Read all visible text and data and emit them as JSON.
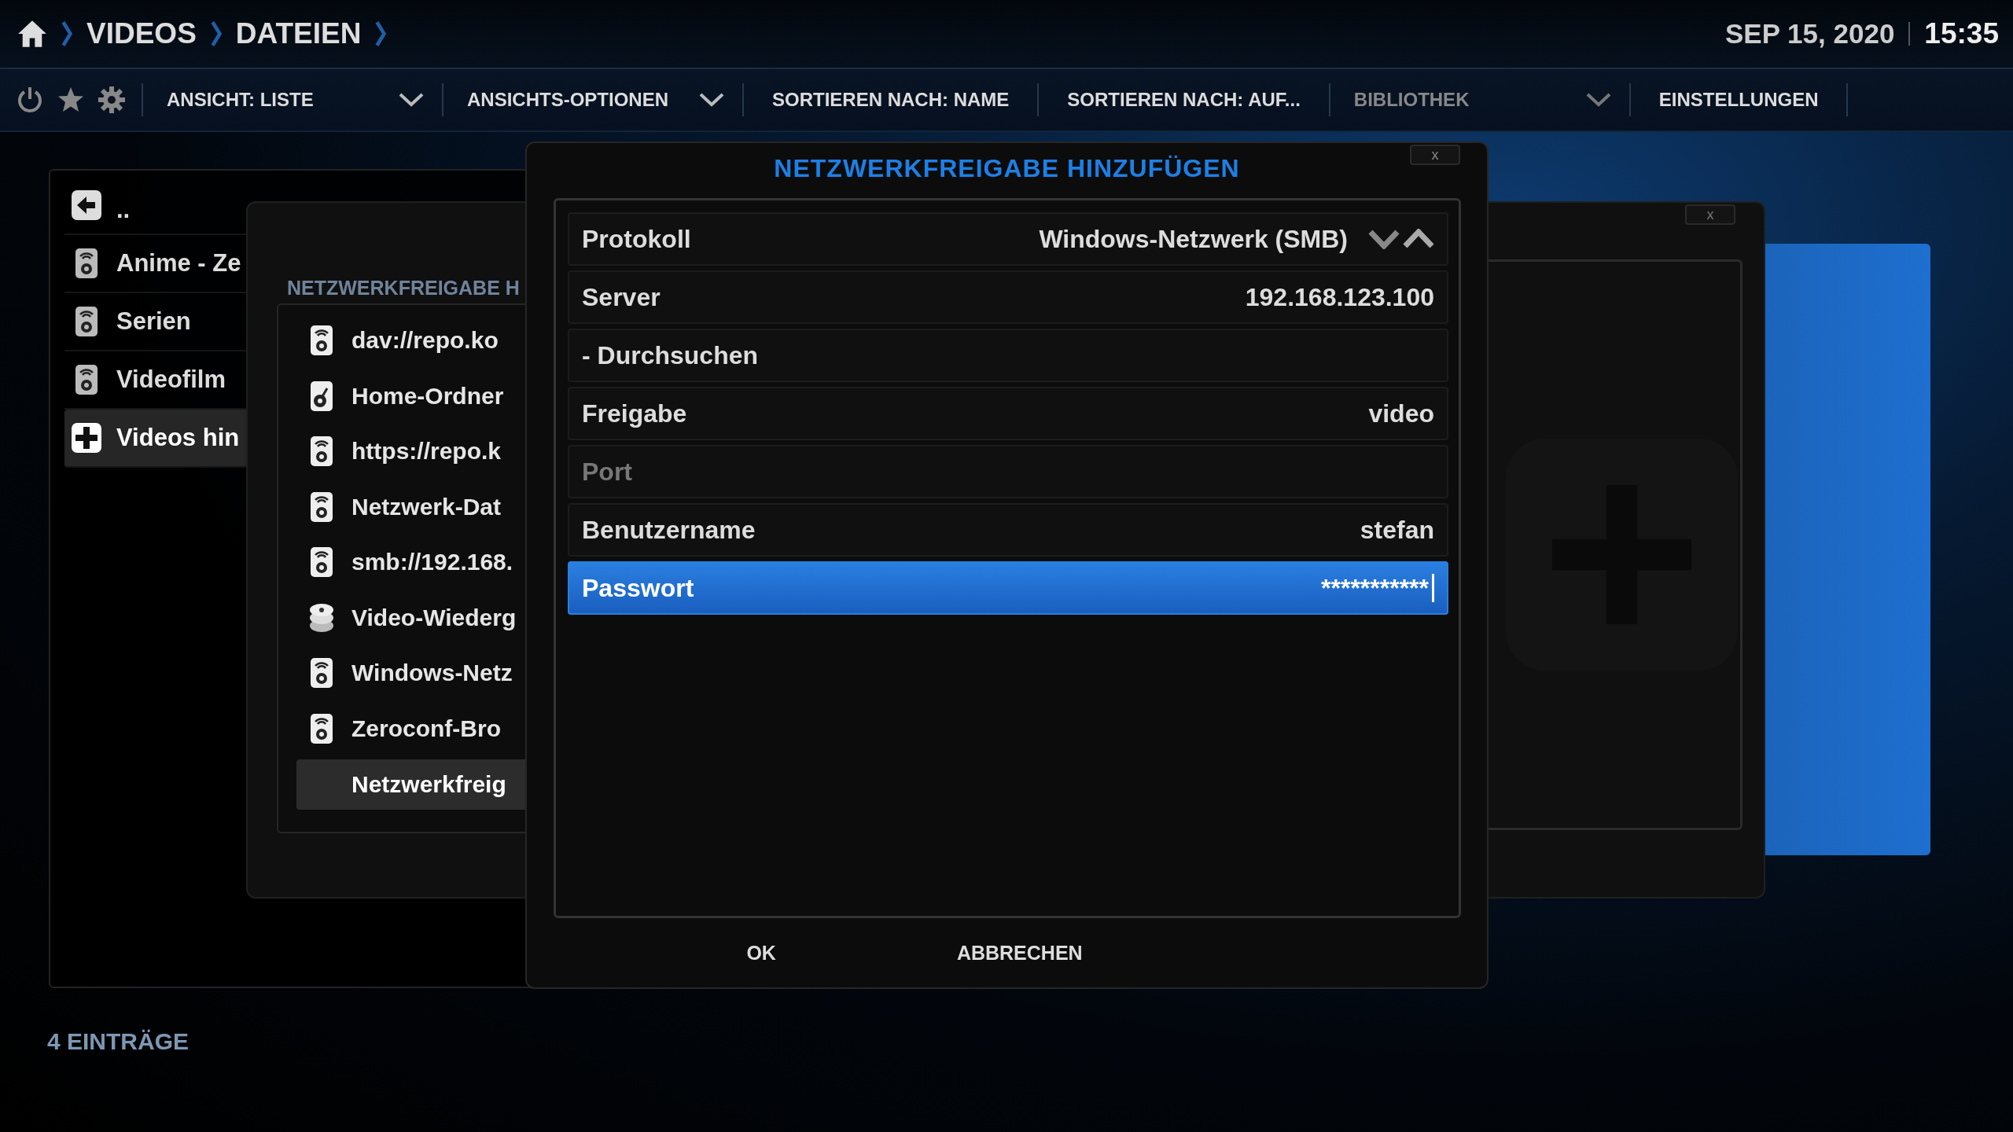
{
  "breadcrumb": [
    {
      "label": "VIDEOS"
    },
    {
      "label": "DATEIEN"
    }
  ],
  "date": "SEP 15, 2020",
  "time": "15:35",
  "toolbar": [
    {
      "label": "ANSICHT: LISTE",
      "dropdown": true,
      "disabled": false
    },
    {
      "label": "ANSICHTS-OPTIONEN",
      "dropdown": true,
      "disabled": false
    },
    {
      "label": "SORTIEREN NACH: NAME",
      "dropdown": false,
      "disabled": false
    },
    {
      "label": "SORTIEREN NACH: AUF...",
      "dropdown": false,
      "disabled": false
    },
    {
      "label": "BIBLIOTHEK",
      "dropdown": true,
      "disabled": true
    },
    {
      "label": "EINSTELLUNGEN",
      "dropdown": false,
      "disabled": false
    }
  ],
  "sources": [
    {
      "label": "..",
      "kind": "back",
      "selected": false
    },
    {
      "label": "Anime - Ze",
      "kind": "network",
      "selected": false
    },
    {
      "label": "Serien",
      "kind": "network",
      "selected": false
    },
    {
      "label": "Videofilm",
      "kind": "network",
      "selected": false
    },
    {
      "label": "Videos hin",
      "kind": "add",
      "selected": true
    }
  ],
  "status": "4 EINTRÄGE",
  "source_dialog": {
    "close": "x"
  },
  "share_list": {
    "title": "NETZWERKFREIGABE H",
    "items": [
      {
        "label": "dav://repo.ko",
        "kind": "network",
        "selected": false
      },
      {
        "label": "Home-Ordner",
        "kind": "home",
        "selected": false
      },
      {
        "label": "https://repo.k",
        "kind": "network",
        "selected": false
      },
      {
        "label": "Netzwerk-Dat",
        "kind": "network",
        "selected": false
      },
      {
        "label": "smb://192.168.",
        "kind": "network",
        "selected": false
      },
      {
        "label": "Video-Wiederg",
        "kind": "playlist",
        "selected": false
      },
      {
        "label": "Windows-Netz",
        "kind": "network",
        "selected": false
      },
      {
        "label": "Zeroconf-Bro",
        "kind": "network",
        "selected": false
      },
      {
        "label": "Netzwerkfreig",
        "kind": "add",
        "selected": true
      }
    ]
  },
  "dialog": {
    "title": "NETZWERKFREIGABE HINZUFÜGEN",
    "close": "x",
    "fields": [
      {
        "label": "Protokoll",
        "value": "Windows-Netzwerk (SMB)",
        "kind": "spinner",
        "selected": false,
        "disabled": false
      },
      {
        "label": "Server",
        "value": "192.168.123.100",
        "kind": "text",
        "selected": false,
        "disabled": false
      },
      {
        "label": "- Durchsuchen",
        "kind": "button",
        "selected": false,
        "disabled": false
      },
      {
        "label": "Freigabe",
        "value": "video",
        "kind": "text",
        "selected": false,
        "disabled": false
      },
      {
        "label": "Port",
        "kind": "text",
        "selected": false,
        "disabled": true
      },
      {
        "label": "Benutzername",
        "value": "stefan",
        "kind": "text",
        "selected": false,
        "disabled": false
      },
      {
        "label": "Passwort",
        "value": "***********",
        "kind": "password",
        "selected": true,
        "disabled": false
      }
    ],
    "buttons": [
      "OK",
      "ABBRECHEN"
    ]
  }
}
